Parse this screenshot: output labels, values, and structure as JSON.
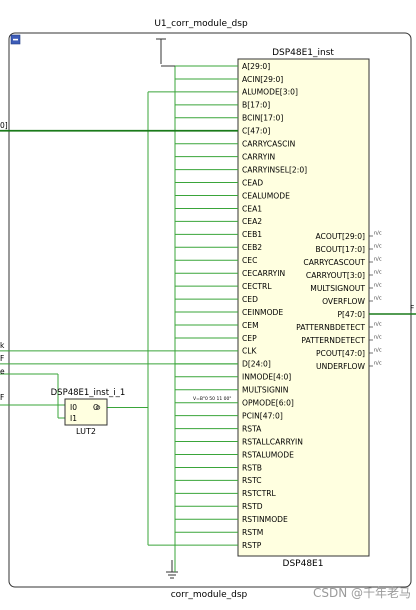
{
  "module": {
    "top_label": "U1_corr_module_dsp",
    "bottom_label": "corr_module_dsp",
    "collapse_glyph": "minus-icon"
  },
  "dsp": {
    "instance_name": "DSP48E1_inst",
    "type_name": "DSP48E1",
    "inputs": [
      "A[29:0]",
      "ACIN[29:0]",
      "ALUMODE[3:0]",
      "B[17:0]",
      "BCIN[17:0]",
      "C[47:0]",
      "CARRYCASCIN",
      "CARRYIN",
      "CARRYINSEL[2:0]",
      "CEAD",
      "CEALUMODE",
      "CEA1",
      "CEA2",
      "CEB1",
      "CEB2",
      "CEC",
      "CECARRYIN",
      "CECTRL",
      "CED",
      "CEINMODE",
      "CEM",
      "CEP",
      "CLK",
      "D[24:0]",
      "INMODE[4:0]",
      "MULTSIGNIN",
      "OPMODE[6:0]",
      "PCIN[47:0]",
      "RSTA",
      "RSTALLCARRYIN",
      "RSTALUMODE",
      "RSTB",
      "RSTC",
      "RSTCTRL",
      "RSTD",
      "RSTINMODE",
      "RSTM",
      "RSTP"
    ],
    "outputs": [
      "ACOUT[29:0]",
      "BCOUT[17:0]",
      "CARRYCASCOUT",
      "CARRYOUT[3:0]",
      "MULTSIGNOUT",
      "OVERFLOW",
      "P[47:0]",
      "PATTERNBDETECT",
      "PATTERNDETECT",
      "PCOUT[47:0]",
      "UNDERFLOW"
    ],
    "nc_label": "n/c",
    "opmode_const": "V=B\"0 50 11 00\""
  },
  "lut": {
    "instance_name": "DSP48E1_inst_i_1",
    "type_name": "LUT2",
    "pins": [
      "I0",
      "I1",
      "O"
    ]
  },
  "ports_left": [
    "0]",
    "k",
    "F",
    "e",
    "F"
  ],
  "ports_right": [
    "F"
  ],
  "watermark": "CSDN @千年老马",
  "colors": {
    "wire": "#3aa53a",
    "bus": "#1a7a1a",
    "block_fill": "#ffffe0",
    "block_stroke": "#333333",
    "frame": "#333333"
  }
}
